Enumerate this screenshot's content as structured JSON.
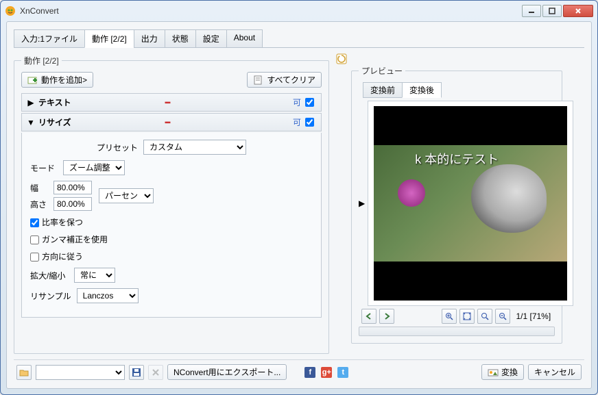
{
  "window": {
    "title": "XnConvert"
  },
  "tabs": {
    "input": "入力:1ファイル",
    "actions": "動作 [2/2]",
    "output": "出力",
    "status": "状態",
    "settings": "設定",
    "about": "About"
  },
  "actions_group": {
    "legend": "動作 [2/2]",
    "add_btn": "動作を追加>",
    "clear_btn": "すべてクリア"
  },
  "action_text": {
    "label": "テキスト",
    "badge": "可"
  },
  "action_resize": {
    "label": "リサイズ",
    "badge": "可",
    "preset_label": "プリセット",
    "preset_value": "カスタム",
    "mode_label": "モード",
    "mode_value": "ズーム調整",
    "width_label": "幅",
    "width_value": "80.00%",
    "height_label": "高さ",
    "height_value": "80.00%",
    "unit_value": "パーセント",
    "keep_ratio": "比率を保つ",
    "gamma": "ガンマ補正を使用",
    "orient": "方向に従う",
    "scale_label": "拡大/縮小",
    "scale_value": "常に",
    "resample_label": "リサンプル",
    "resample_value": "Lanczos"
  },
  "preview": {
    "legend": "プレビュー",
    "before_tab": "変換前",
    "after_tab": "変換後",
    "overlay_text": "k 本的にテスト",
    "counter": "1/1 [71%]"
  },
  "footer": {
    "export_btn": "NConvert用にエクスポート...",
    "convert_btn": "変換",
    "cancel_btn": "キャンセル"
  }
}
